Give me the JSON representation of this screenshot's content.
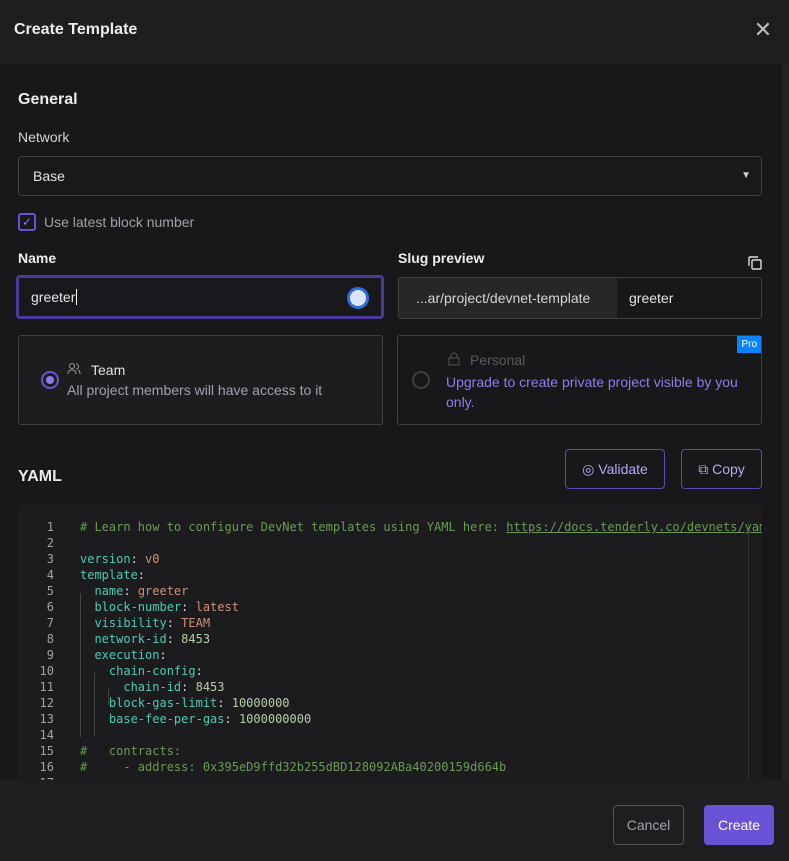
{
  "dialog": {
    "title": "Create Template"
  },
  "general": {
    "heading": "General",
    "network_label": "Network",
    "network_value": "Base",
    "use_latest_label": "Use latest block number",
    "use_latest_checked": true
  },
  "name": {
    "label": "Name",
    "value": "greeter"
  },
  "slug": {
    "label": "Slug preview",
    "prefix": "...ar/project/devnet-template",
    "value": "greeter"
  },
  "visibility": {
    "team": {
      "title": "Team",
      "desc": "All project members will have access to it",
      "selected": true
    },
    "personal": {
      "title": "Personal",
      "desc": "Upgrade to create private project visible by you only.",
      "badge": "Pro",
      "selected": false
    }
  },
  "yaml": {
    "heading": "YAML",
    "validate_label": "Validate",
    "copy_label": "Copy",
    "lines": [
      [
        [
          "c",
          "# Learn how to configure DevNet templates using YAML here: "
        ],
        [
          "u",
          "https://docs.tenderly.co/devnets/yaml"
        ]
      ],
      [],
      [
        [
          "k",
          "version"
        ],
        [
          "p",
          ": "
        ],
        [
          "s",
          "v0"
        ]
      ],
      [
        [
          "k",
          "template"
        ],
        [
          "p",
          ":"
        ]
      ],
      [
        [
          "p",
          "  "
        ],
        [
          "k",
          "name"
        ],
        [
          "p",
          ": "
        ],
        [
          "s",
          "greeter"
        ]
      ],
      [
        [
          "p",
          "  "
        ],
        [
          "k",
          "block-number"
        ],
        [
          "p",
          ": "
        ],
        [
          "s",
          "latest"
        ]
      ],
      [
        [
          "p",
          "  "
        ],
        [
          "k",
          "visibility"
        ],
        [
          "p",
          ": "
        ],
        [
          "s",
          "TEAM"
        ]
      ],
      [
        [
          "p",
          "  "
        ],
        [
          "k",
          "network-id"
        ],
        [
          "p",
          ": "
        ],
        [
          "n",
          "8453"
        ]
      ],
      [
        [
          "p",
          "  "
        ],
        [
          "k",
          "execution"
        ],
        [
          "p",
          ":"
        ]
      ],
      [
        [
          "p",
          "    "
        ],
        [
          "k",
          "chain-config"
        ],
        [
          "p",
          ":"
        ]
      ],
      [
        [
          "p",
          "      "
        ],
        [
          "k",
          "chain-id"
        ],
        [
          "p",
          ": "
        ],
        [
          "n",
          "8453"
        ]
      ],
      [
        [
          "p",
          "    "
        ],
        [
          "k",
          "block-gas-limit"
        ],
        [
          "p",
          ": "
        ],
        [
          "n",
          "10000000"
        ]
      ],
      [
        [
          "p",
          "    "
        ],
        [
          "k",
          "base-fee-per-gas"
        ],
        [
          "p",
          ": "
        ],
        [
          "n",
          "1000000000"
        ]
      ],
      [],
      [
        [
          "c",
          "#   contracts:"
        ]
      ],
      [
        [
          "c",
          "#     - address: 0x395eD9ffd32b255dBD128092ABa40200159d664b"
        ]
      ],
      []
    ]
  },
  "footer": {
    "cancel_label": "Cancel",
    "create_label": "Create"
  },
  "colors": {
    "accent": "#6a52d4",
    "focus": "#4b3a9c",
    "pro_badge": "#0a84ff"
  }
}
